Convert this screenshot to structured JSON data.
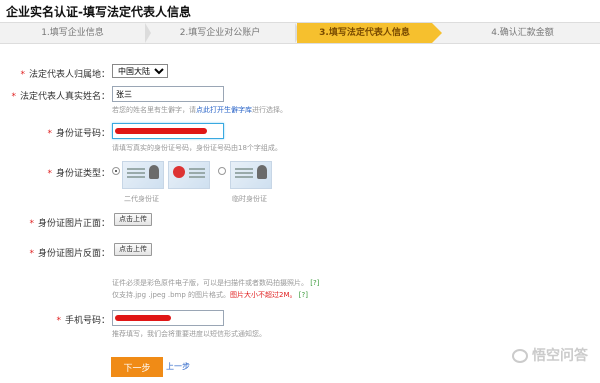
{
  "page": {
    "title": "企业实名认证-填写法定代表人信息"
  },
  "steps": [
    {
      "label": "1.填写企业信息",
      "active": false
    },
    {
      "label": "2.填写企业对公账户",
      "active": false
    },
    {
      "label": "3.填写法定代表人信息",
      "active": true
    },
    {
      "label": "4.确认汇款金额",
      "active": false
    }
  ],
  "form": {
    "country": {
      "label": "法定代表人归属地：",
      "value": "中国大陆"
    },
    "name": {
      "label": "法定代表人真实姓名：",
      "value": "张三",
      "hint_prefix": "若您的姓名里有生僻字，请",
      "hint_link": "点此打开生僻字库",
      "hint_suffix": "进行选择。"
    },
    "idnumber": {
      "label": "身份证号码：",
      "hint": "请填写真实的身份证号码，身份证号码由18个字组成。"
    },
    "idtype": {
      "label": "身份证类型：",
      "option1": "二代身份证",
      "option2": "临时身份证"
    },
    "front": {
      "label": "身份证图片正面：",
      "button": "点击上传"
    },
    "back": {
      "label": "身份证图片反面：",
      "button": "点击上传"
    },
    "upload_hint": {
      "line1": "证件必须是彩色原件电子版，可以是扫描件或者数码拍摄照片。",
      "line1_tag": "[?]",
      "line2_prefix": "仅支持.jpg .jpeg .bmp 的图片格式。",
      "line2_red": "图片大小不超过2M。",
      "line2_tag": "[?]"
    },
    "phone": {
      "label": "手机号码：",
      "hint": "推荐填写，我们会将重要进度以短信形式通知您。"
    }
  },
  "actions": {
    "next": "下一步",
    "prev": "上一步"
  },
  "watermark": {
    "text": "悟空问答"
  }
}
